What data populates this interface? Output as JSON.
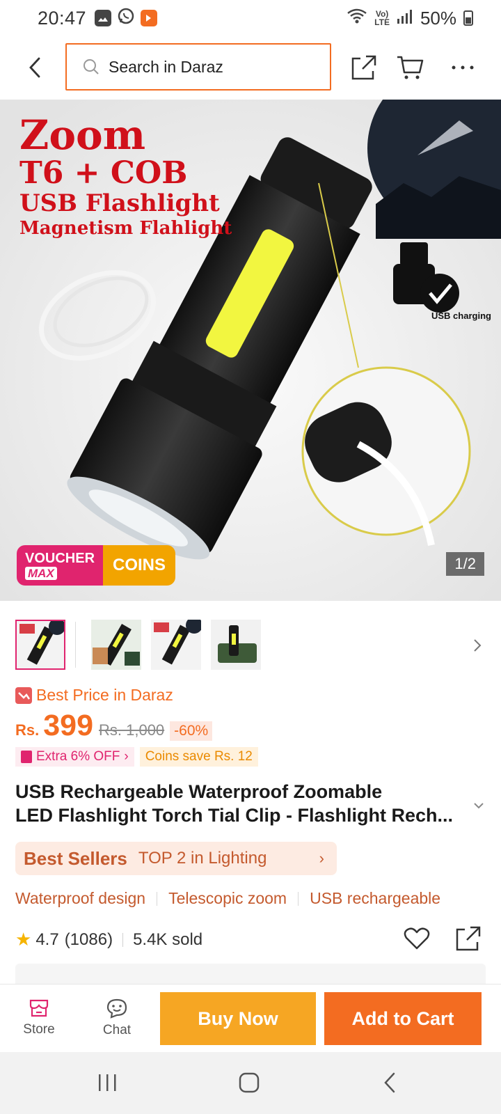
{
  "status_bar": {
    "time": "20:47",
    "battery": "50%",
    "network_top": "Vo)",
    "network_bottom": "LTE",
    "icons": [
      "gallery-icon",
      "whatsapp-icon",
      "daraz-icon",
      "wifi-icon",
      "signal-icon",
      "battery-icon"
    ]
  },
  "header": {
    "search_placeholder": "Search in Daraz",
    "icons": [
      "back-icon",
      "search-icon",
      "share-icon",
      "cart-icon",
      "more-icon"
    ]
  },
  "gallery": {
    "title_lines": [
      "Zoom",
      "T6 + COB",
      "USB Flashlight",
      "Magnetism Flahlight"
    ],
    "usb_label": "USB charging",
    "voucher_top": "VOUCHER",
    "voucher_bottom": "MAX",
    "coins_label": "COINS",
    "page_indicator": "1/2",
    "thumbnail_count": 4
  },
  "product": {
    "best_price_label": "Best Price in Daraz",
    "currency": "Rs.",
    "price": "399",
    "original_price": "Rs. 1,000",
    "discount": "-60%",
    "extra_off": "Extra 6% OFF",
    "coins_save": "Coins save Rs. 12",
    "title_line1": "USB Rechargeable Waterproof Zoomable",
    "title_line2": "LED Flashlight Torch Tial Clip - Flashlight Rech...",
    "bestsellers_label": "Best Sellers",
    "bestsellers_rank": "TOP 2 in Lighting",
    "features": [
      "Waterproof design",
      "Telescopic zoom",
      "USB rechargeable"
    ],
    "rating": "4.7",
    "review_count": "(1086)",
    "sold": "5.4K sold"
  },
  "bottom_bar": {
    "store_label": "Store",
    "chat_label": "Chat",
    "buy_now_label": "Buy Now",
    "add_to_cart_label": "Add to Cart"
  },
  "colors": {
    "brand_orange": "#f36c21",
    "buy_now_yellow": "#f6a623",
    "voucher_pink": "#e0246e"
  }
}
